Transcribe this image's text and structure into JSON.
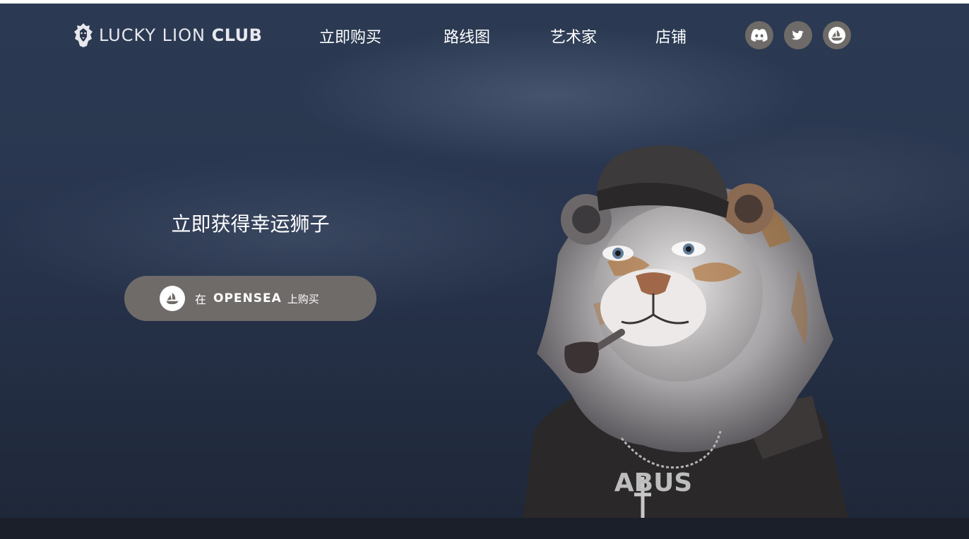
{
  "header": {
    "logo": {
      "light": "LUCKY LION ",
      "bold": "CLUB",
      "icon": "lion-head-icon"
    },
    "nav": [
      "立即购买",
      "路线图",
      "艺术家",
      "店铺"
    ],
    "social": [
      {
        "name": "discord",
        "icon": "discord-icon"
      },
      {
        "name": "twitter",
        "icon": "twitter-icon"
      },
      {
        "name": "opensea",
        "icon": "opensea-icon"
      }
    ]
  },
  "hero": {
    "title": "立即获得幸运狮子",
    "cta": {
      "pre": "在",
      "brand": "OPENSEA",
      "post": "上购买",
      "icon": "opensea-icon"
    },
    "artwork": {
      "necklace_text": "ABUS",
      "description_icon": "lion-character-icon"
    }
  },
  "colors": {
    "background_top": "#2b3a52",
    "background_bottom": "#1f2839",
    "button": "#6f6b69",
    "social_bg": "#6d6a68",
    "text": "#ffffff"
  }
}
